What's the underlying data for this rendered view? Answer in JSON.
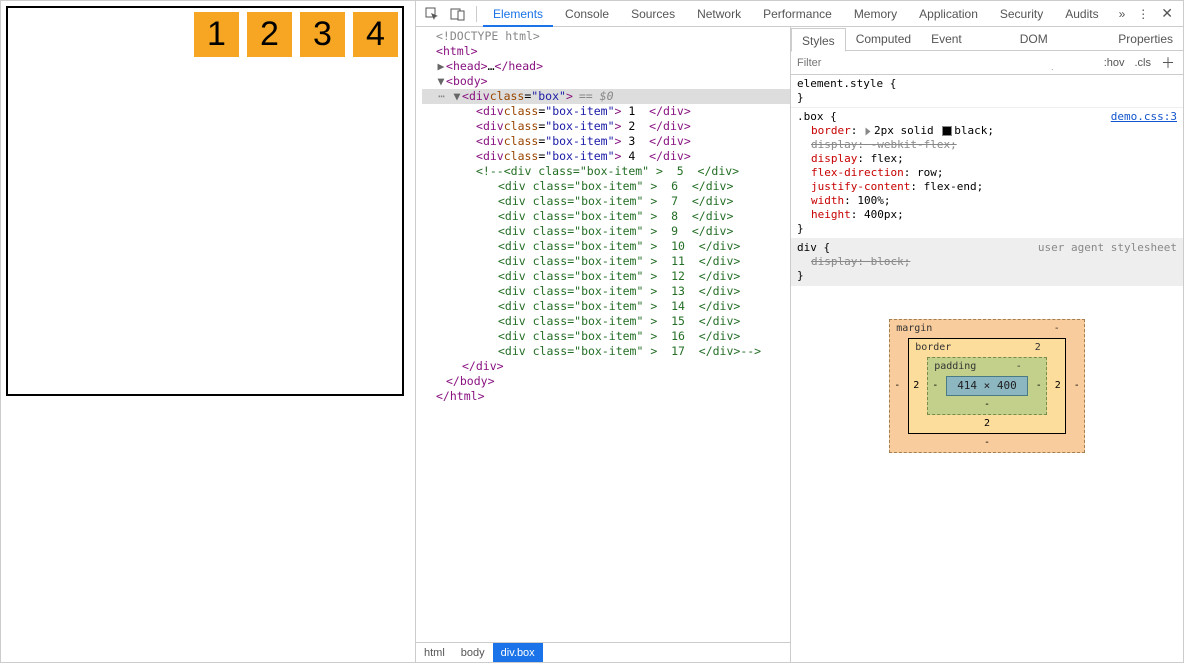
{
  "preview": {
    "items": [
      "1",
      "2",
      "3",
      "4"
    ]
  },
  "devtools_tabs": [
    "Elements",
    "Console",
    "Sources",
    "Network",
    "Performance",
    "Memory",
    "Application",
    "Security",
    "Audits"
  ],
  "devtools_active_tab": "Elements",
  "dom": {
    "doctype": "<!DOCTYPE html>",
    "html_open": "html",
    "head_open": "head",
    "head_ellipsis": "…",
    "body_open": "body",
    "box_open_tag": "div",
    "box_open_attr_name": "class",
    "box_open_attr_val": "box",
    "selected_hint": "== $0",
    "box_item_attr_name": "class",
    "box_item_attr_val": "box-item",
    "items": [
      "1",
      "2",
      "3",
      "4"
    ],
    "comment_items": [
      "5",
      "6",
      "7",
      "8",
      "9",
      "10",
      "11",
      "12",
      "13",
      "14",
      "15",
      "16",
      "17"
    ]
  },
  "breadcrumb": [
    "html",
    "body",
    "div.box"
  ],
  "styles_tabs": [
    "Styles",
    "Computed",
    "Event Listeners",
    "DOM Breakpoints",
    "Properties"
  ],
  "styles_active_tab": "Styles",
  "filter_placeholder": "Filter",
  "filter_right": [
    ":hov",
    ".cls"
  ],
  "rules": {
    "element_style": {
      "selector": "element.style"
    },
    "box": {
      "selector": ".box",
      "source": "demo.css:3",
      "props": [
        {
          "name": "border",
          "value": "2px solid",
          "color": "black",
          "prefix_tri": true
        },
        {
          "name": "display",
          "value": "-webkit-flex",
          "strike": true
        },
        {
          "name": "display",
          "value": "flex"
        },
        {
          "name": "flex-direction",
          "value": "row"
        },
        {
          "name": "justify-content",
          "value": "flex-end"
        },
        {
          "name": "width",
          "value": "100%"
        },
        {
          "name": "height",
          "value": "400px"
        }
      ]
    },
    "div_ua": {
      "selector": "div",
      "source": "user agent stylesheet",
      "props": [
        {
          "name": "display",
          "value": "block",
          "strike": true
        }
      ]
    }
  },
  "box_model": {
    "margin_label": "margin",
    "border_label": "border",
    "padding_label": "padding",
    "margin": "-",
    "border": "2",
    "padding": "-",
    "content": "414 × 400"
  }
}
